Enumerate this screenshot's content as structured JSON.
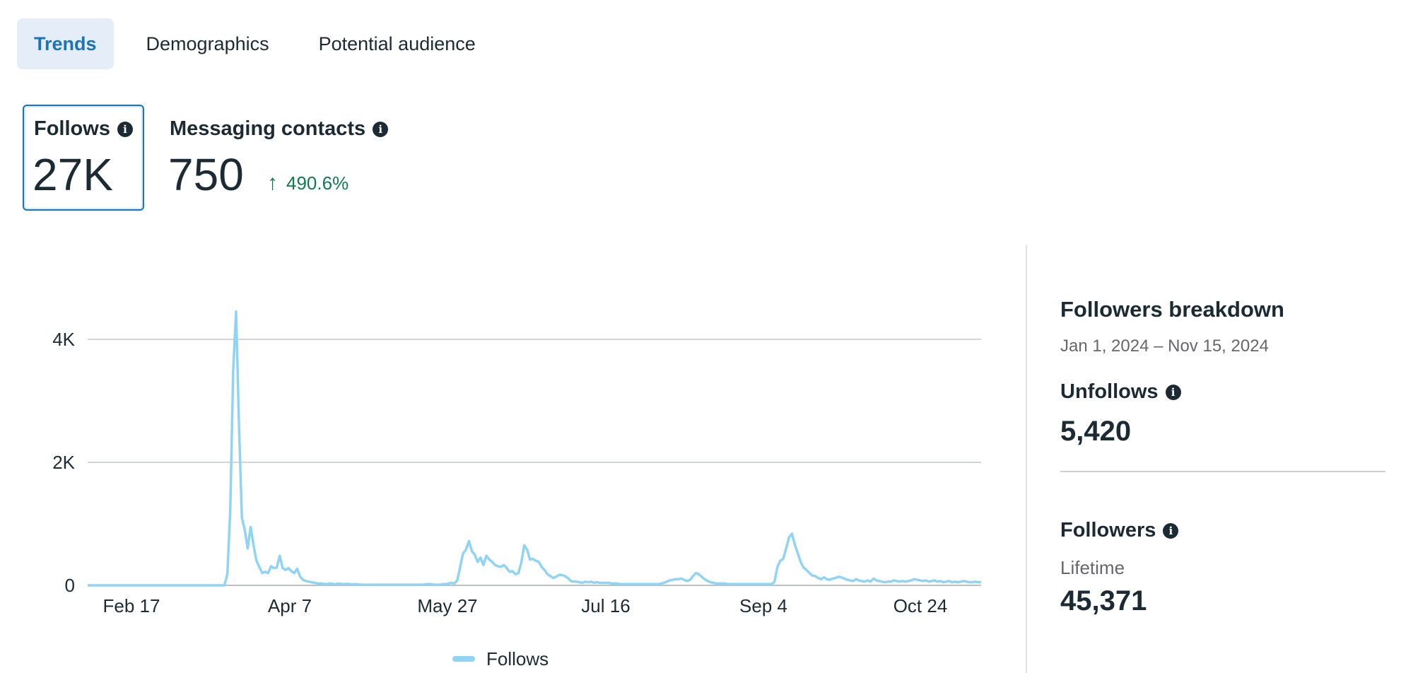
{
  "tabs": [
    {
      "label": "Trends",
      "active": true
    },
    {
      "label": "Demographics",
      "active": false
    },
    {
      "label": "Potential audience",
      "active": false
    }
  ],
  "metrics": {
    "follows": {
      "label": "Follows",
      "value": "27K"
    },
    "messaging": {
      "label": "Messaging contacts",
      "value": "750",
      "delta": "490.6%",
      "delta_arrow": "↑"
    }
  },
  "colors": {
    "accent": "#1b74b8",
    "series": "#8fd4f5",
    "positive": "#0f7b4f"
  },
  "chart_data": {
    "type": "line",
    "x_ticks": [
      "Feb 17",
      "Apr 7",
      "May 27",
      "Jul 16",
      "Sep 4",
      "Oct 24"
    ],
    "y_ticks": [
      "0",
      "2K",
      "4K"
    ],
    "ylim": [
      0,
      4000
    ],
    "grid": true,
    "legend_position": "bottom",
    "series": [
      {
        "name": "Follows",
        "values": [
          0,
          0,
          0,
          0,
          0,
          0,
          0,
          0,
          0,
          0,
          0,
          0,
          0,
          0,
          0,
          0,
          0,
          0,
          0,
          0,
          0,
          0,
          0,
          0,
          0,
          0,
          0,
          0,
          0,
          0,
          0,
          0,
          0,
          0,
          0,
          0,
          0,
          0,
          0,
          0,
          0,
          0,
          0,
          0,
          0,
          0,
          0,
          0,
          180,
          1200,
          3500,
          4450,
          2600,
          1100,
          900,
          600,
          950,
          650,
          400,
          300,
          200,
          220,
          200,
          310,
          280,
          290,
          480,
          280,
          250,
          280,
          230,
          200,
          270,
          140,
          90,
          70,
          60,
          50,
          40,
          30,
          30,
          25,
          20,
          30,
          25,
          20,
          30,
          25,
          20,
          25,
          20,
          15,
          20,
          15,
          10,
          10,
          10,
          10,
          10,
          10,
          10,
          10,
          10,
          10,
          10,
          10,
          10,
          10,
          10,
          10,
          10,
          10,
          10,
          10,
          10,
          10,
          15,
          20,
          20,
          10,
          10,
          10,
          20,
          20,
          30,
          40,
          30,
          80,
          300,
          520,
          580,
          720,
          560,
          500,
          380,
          450,
          330,
          480,
          420,
          380,
          330,
          310,
          300,
          330,
          280,
          220,
          230,
          180,
          200,
          370,
          650,
          580,
          420,
          430,
          400,
          380,
          300,
          250,
          180,
          150,
          120,
          140,
          170,
          170,
          150,
          120,
          70,
          60,
          60,
          50,
          40,
          60,
          50,
          60,
          40,
          50,
          40,
          40,
          40,
          40,
          30,
          30,
          30,
          20,
          20,
          20,
          20,
          20,
          20,
          20,
          20,
          20,
          20,
          20,
          20,
          20,
          20,
          30,
          40,
          60,
          80,
          90,
          100,
          100,
          110,
          90,
          70,
          90,
          150,
          200,
          180,
          140,
          100,
          70,
          50,
          40,
          30,
          30,
          30,
          30,
          20,
          20,
          20,
          20,
          20,
          20,
          20,
          20,
          20,
          20,
          20,
          20,
          20,
          20,
          20,
          20,
          60,
          300,
          400,
          430,
          600,
          780,
          840,
          660,
          520,
          380,
          290,
          250,
          200,
          160,
          150,
          120,
          100,
          130,
          100,
          90,
          110,
          120,
          140,
          130,
          110,
          90,
          80,
          70,
          100,
          80,
          70,
          60,
          80,
          60,
          110,
          80,
          70,
          60,
          50,
          60,
          60,
          80,
          70,
          60,
          70,
          60,
          70,
          80,
          100,
          90,
          80,
          70,
          80,
          60,
          70,
          80,
          60,
          70,
          50,
          60,
          70,
          50,
          60,
          50,
          60,
          70,
          60,
          50,
          50,
          60,
          50,
          50
        ]
      }
    ]
  },
  "sidebar": {
    "title": "Followers breakdown",
    "range": "Jan 1, 2024 – Nov 15, 2024",
    "unfollows_label": "Unfollows",
    "unfollows_value": "5,420",
    "followers_label": "Followers",
    "followers_sub": "Lifetime",
    "followers_value": "45,371"
  }
}
